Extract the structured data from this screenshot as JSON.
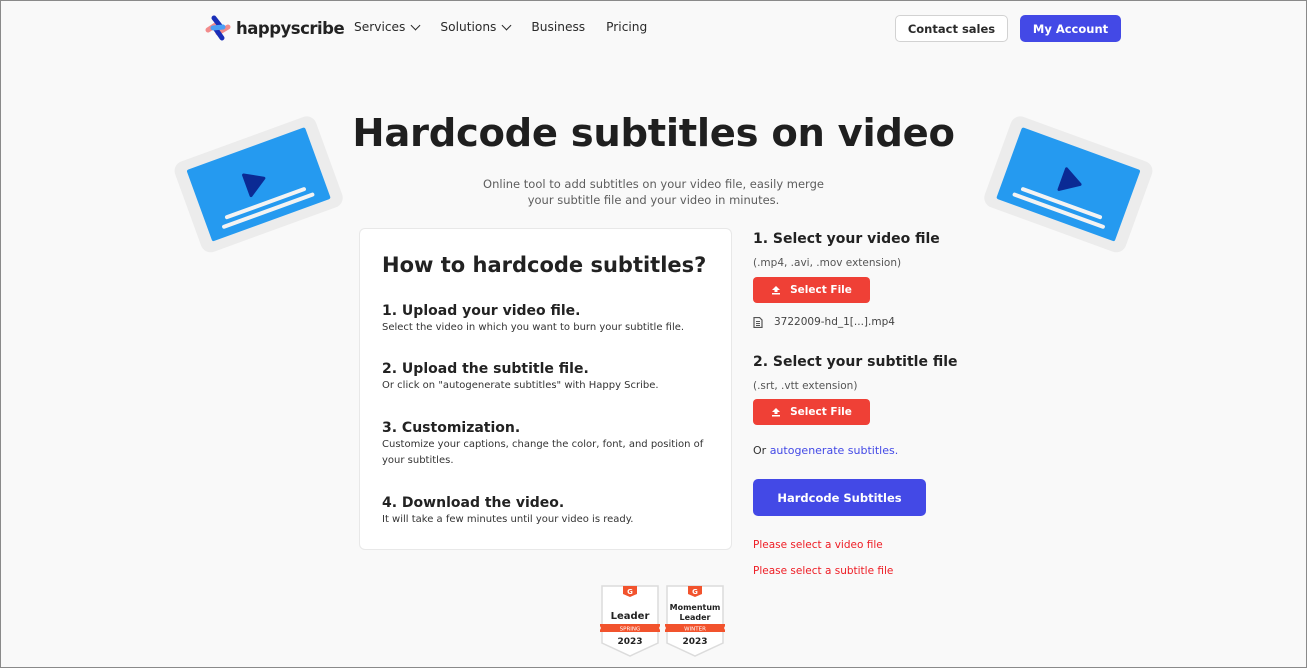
{
  "nav": {
    "logo_text": "happyscribe",
    "links": [
      {
        "label": "Services",
        "has_dropdown": true
      },
      {
        "label": "Solutions",
        "has_dropdown": true
      },
      {
        "label": "Business",
        "has_dropdown": false
      },
      {
        "label": "Pricing",
        "has_dropdown": false
      }
    ],
    "contact_label": "Contact sales",
    "account_label": "My Account"
  },
  "hero": {
    "title": "Hardcode subtitles on video",
    "subtitle_line1": "Online tool to add subtitles on your video file, easily merge",
    "subtitle_line2": "your subtitle file and your video in minutes."
  },
  "howto": {
    "title": "How to hardcode subtitles?",
    "steps": [
      {
        "title": "1. Upload your video file.",
        "desc": "Select the video in which you want to burn your subtitle file."
      },
      {
        "title": "2. Upload the subtitle file.",
        "desc": "Or click on \"autogenerate subtitles\" with Happy Scribe."
      },
      {
        "title": "3. Customization.",
        "desc": "Customize your captions, change the color, font, and position of your subtitles."
      },
      {
        "title": "4. Download the video.",
        "desc": "It will take a few minutes until your video is ready."
      }
    ]
  },
  "form": {
    "video": {
      "title": "1.  Select your video file",
      "hint": "(.mp4, .avi, .mov extension)",
      "button_label": "Select File",
      "selected_file": "3722009-hd_1[...].mp4"
    },
    "subtitle": {
      "title": "2.  Select your subtitle file",
      "hint": "(.srt, .vtt extension)",
      "button_label": "Select File"
    },
    "or_text": "Or ",
    "autogen_link": "autogenerate subtitles.",
    "submit_label": "Hardcode Subtitles",
    "errors": [
      "Please select a video file",
      "Please select a subtitle file"
    ]
  },
  "badges": [
    {
      "brand": "G",
      "title_line1": "Leader",
      "title_line2": "",
      "ribbon": "SPRING",
      "year": "2023"
    },
    {
      "brand": "G",
      "title_line1": "Momentum",
      "title_line2": "Leader",
      "ribbon": "WINTER",
      "year": "2023"
    }
  ],
  "colors": {
    "brand_blue": "#4349e6",
    "select_red": "#ef4036",
    "error_red": "#ee1c24",
    "illustration_blue": "#259af0",
    "illustration_play": "#0b2a94"
  }
}
